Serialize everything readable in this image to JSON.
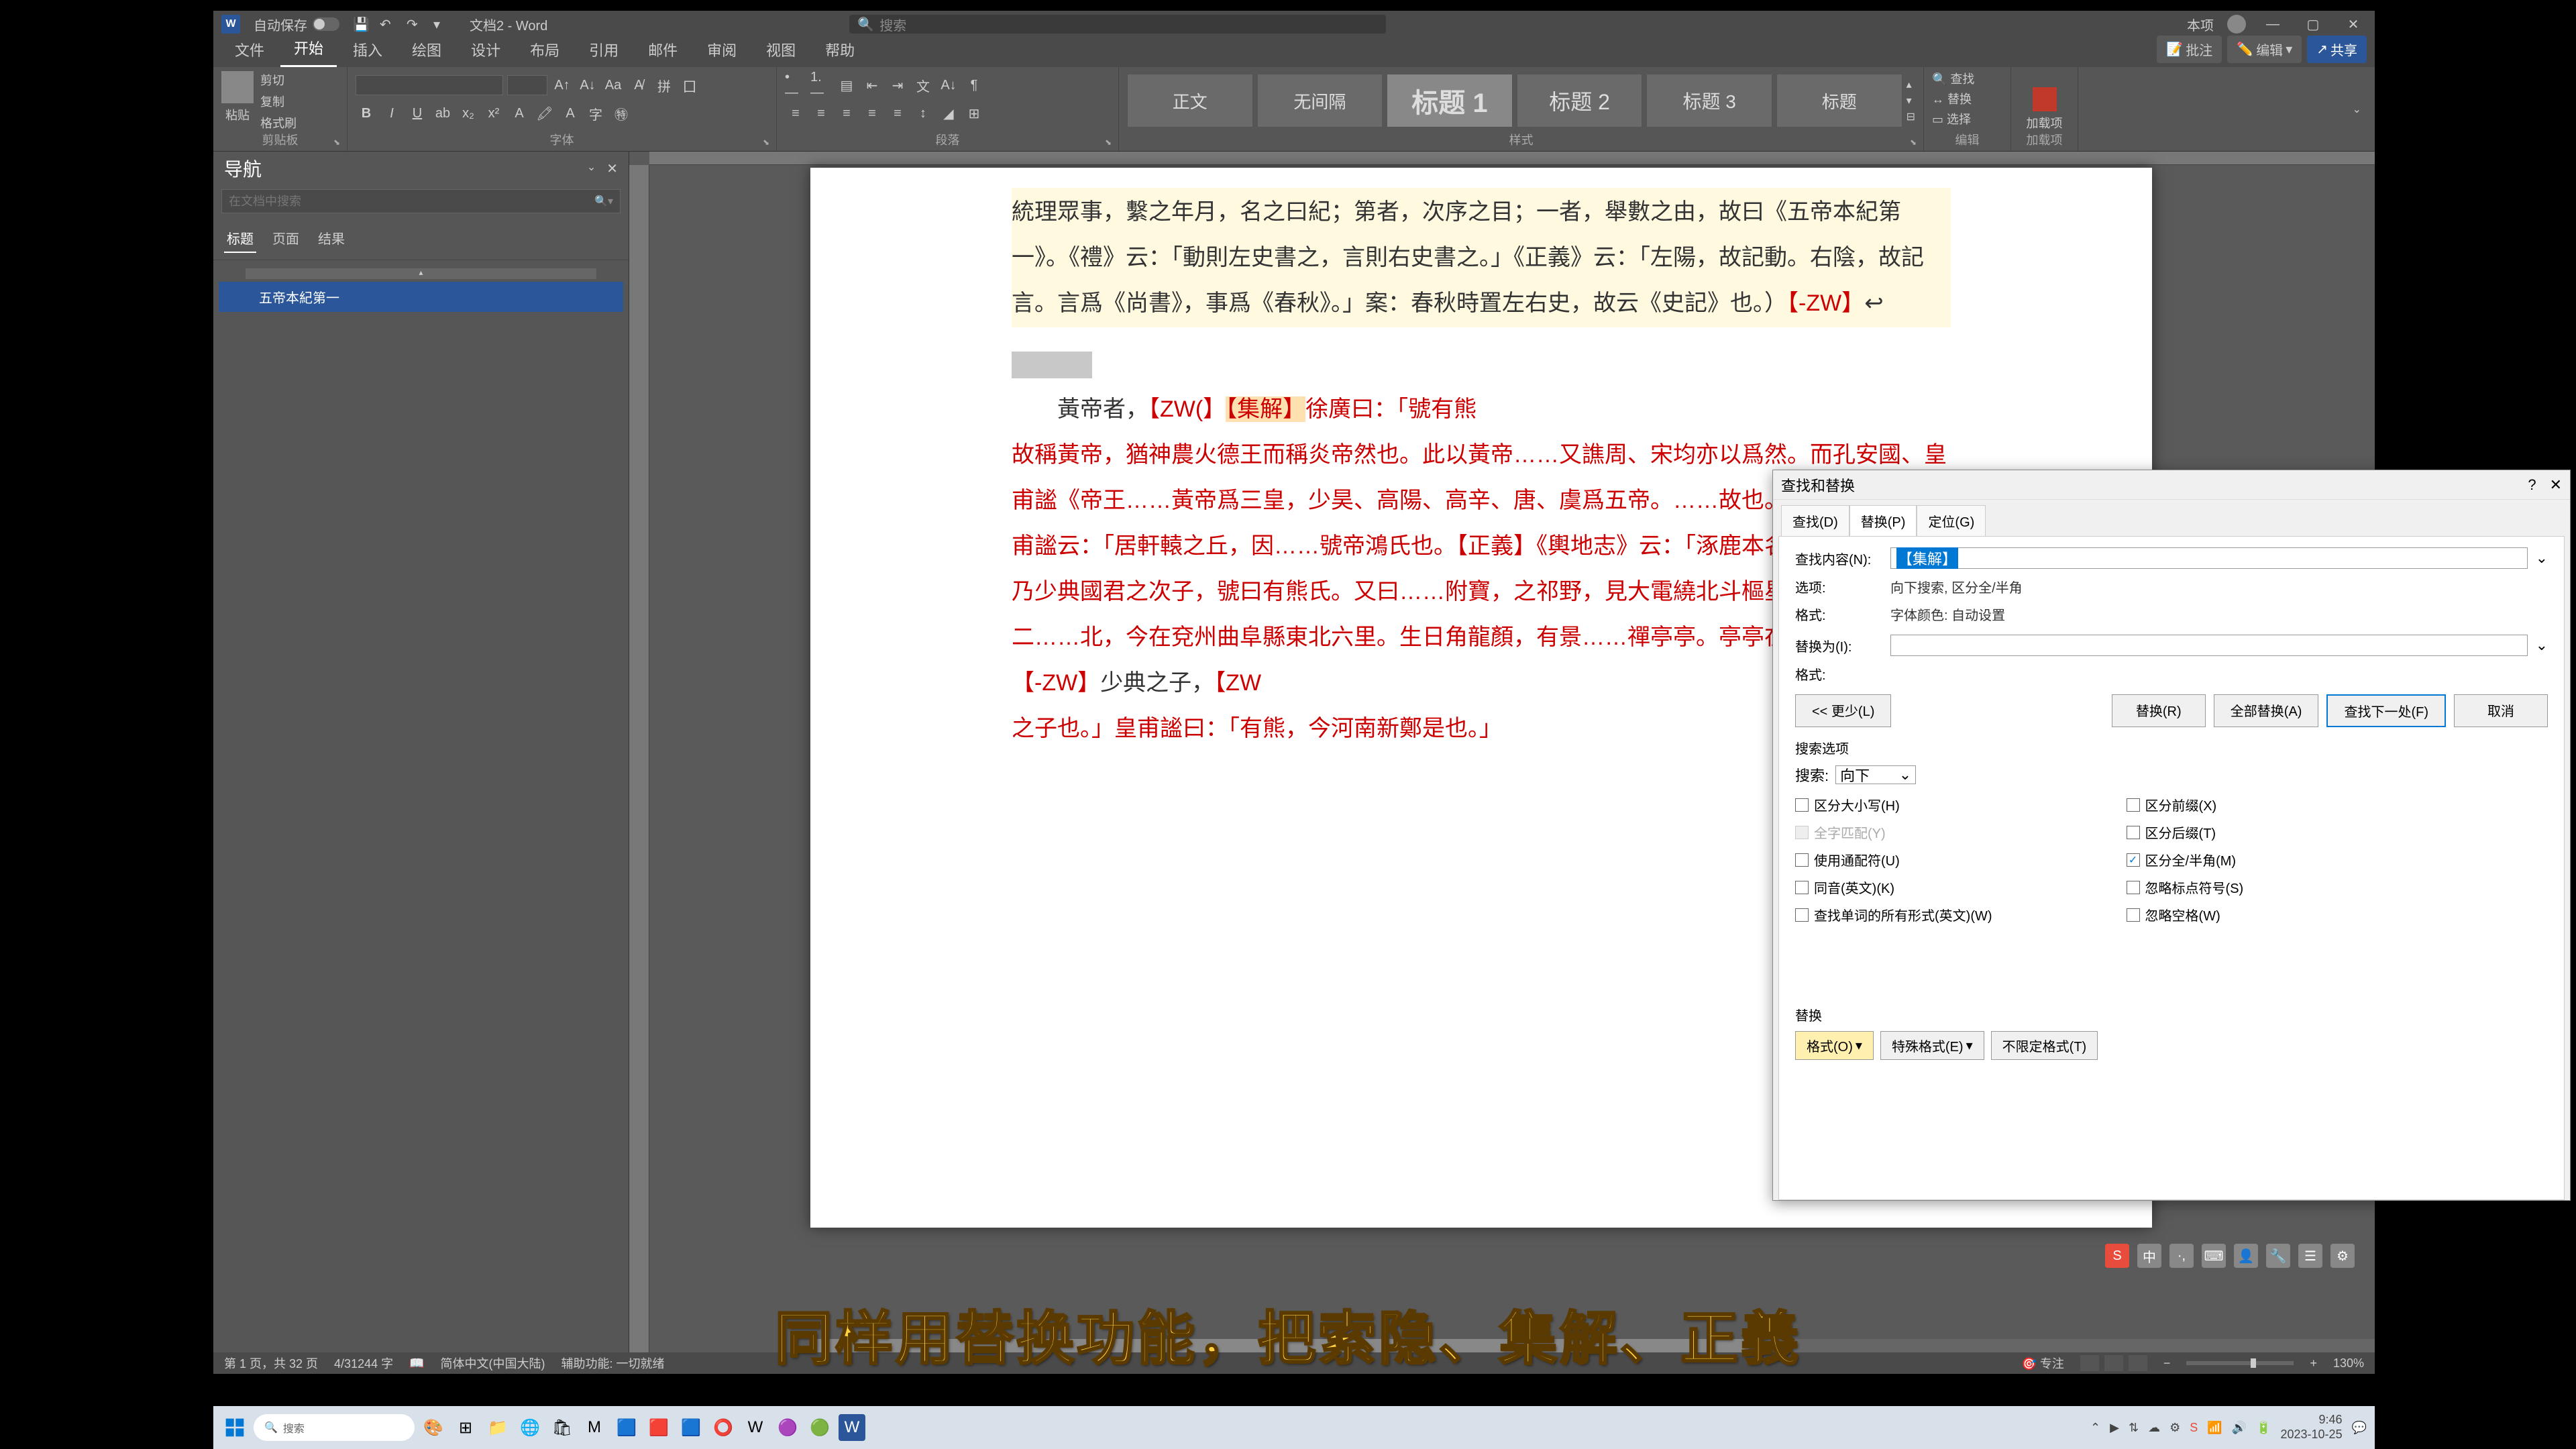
{
  "title_bar": {
    "autosave_label": "自动保存",
    "doc_title": "文档2 - Word",
    "search_placeholder": "搜索",
    "ribbon_display": "本项"
  },
  "ribbon_tabs": [
    "文件",
    "开始",
    "插入",
    "绘图",
    "设计",
    "布局",
    "引用",
    "邮件",
    "审阅",
    "视图",
    "帮助"
  ],
  "ribbon_active_tab": 1,
  "ribbon_right": {
    "comments": "批注",
    "edit": "编辑",
    "share": "共享"
  },
  "ribbon_groups": {
    "clipboard": {
      "label": "剪贴板",
      "paste": "粘贴",
      "cut": "剪切",
      "copy": "复制",
      "format_painter": "格式刷"
    },
    "font": {
      "label": "字体"
    },
    "paragraph": {
      "label": "段落"
    },
    "styles": {
      "label": "样式",
      "items": [
        "正文",
        "无间隔",
        "标题 1",
        "标题 2",
        "标题 3",
        "标题"
      ]
    },
    "editing": {
      "label": "编辑",
      "find": "查找",
      "replace": "替换",
      "select": "选择"
    },
    "addins": {
      "label": "加载项",
      "add": "加载项"
    }
  },
  "nav_pane": {
    "title": "导航",
    "search_placeholder": "在文档中搜索",
    "tabs": [
      "标题",
      "页面",
      "结果"
    ],
    "active_tab": 0,
    "items": [
      "五帝本紀第一"
    ]
  },
  "document": {
    "para1": "統理眾事，繫之年月，名之曰紀；第者，次序之目；一者，舉數之由，故曰《五帝本紀第一》。《禮》云：「動則左史書之，言則右史書之。」《正義》云：「左陽，故記動。右陰，故記言。言爲《尚書》，事爲《春秋》。」案：春秋時置左右史，故云《史記》也。）",
    "zw_close1": "【-ZW】",
    "para2_start": "　　黃帝者，",
    "zw_open": "【ZW(】",
    "jijie": "【集解】",
    "para2_cont": "徐廣曰：「號有熊",
    "para_red_body": "故稱黃帝，猶神農火德王而稱炎帝然也。此以黃帝……又譙周、宋均亦以爲然。而孔安國、皇甫謐《帝王……黃帝爲三皇，少昊、高陽、高辛、唐、虞爲五帝。……故也。亦號軒轅氏。皇甫謐云：「居軒轅之丘，因……號帝鴻氏也。【正義】《輿地志》云：「涿鹿本名……有熊國君，乃少典國君之次子，號曰有熊氏。又曰……附寶，之祁野，見大電繞北斗樞星，感而懷孕，二……北，今在兗州曲阜縣東北六里。生日角龍顏，有景……禪亭亭。亭亭在牟陰。）",
    "zw_close2": "【-ZW】",
    "para2_end": "少典之子，",
    "zw_open2": "【ZW",
    "para3": "之子也。」皇甫謐曰：「有熊，今河南新鄭是也。」"
  },
  "dialog": {
    "title": "查找和替换",
    "tabs": [
      "查找(D)",
      "替换(P)",
      "定位(G)"
    ],
    "active_tab": 1,
    "find_label": "查找内容(N):",
    "find_value": "【集解】",
    "options_label": "选项:",
    "options_value": "向下搜索, 区分全/半角",
    "format_label": "格式:",
    "format_value": "字体颜色: 自动设置",
    "replace_label": "替换为(I):",
    "replace_value": "",
    "format2_label": "格式:",
    "less_btn": "<< 更少(L)",
    "replace_btn": "替换(R)",
    "replace_all_btn": "全部替换(A)",
    "find_next_btn": "查找下一处(F)",
    "cancel_btn": "取消",
    "search_options_title": "搜索选项",
    "search_label": "搜索:",
    "search_direction": "向下",
    "checkboxes_left": [
      {
        "label": "区分大小写(H)",
        "checked": false,
        "disabled": false
      },
      {
        "label": "全字匹配(Y)",
        "checked": false,
        "disabled": true
      },
      {
        "label": "使用通配符(U)",
        "checked": false,
        "disabled": false
      },
      {
        "label": "同音(英文)(K)",
        "checked": false,
        "disabled": false
      },
      {
        "label": "查找单词的所有形式(英文)(W)",
        "checked": false,
        "disabled": false
      }
    ],
    "checkboxes_right": [
      {
        "label": "区分前缀(X)",
        "checked": false
      },
      {
        "label": "区分后缀(T)",
        "checked": false
      },
      {
        "label": "区分全/半角(M)",
        "checked": true
      },
      {
        "label": "忽略标点符号(S)",
        "checked": false
      },
      {
        "label": "忽略空格(W)",
        "checked": false
      }
    ],
    "replace_section_title": "替换",
    "format_btn": "格式(O)",
    "special_btn": "特殊格式(E)",
    "no_format_btn": "不限定格式(T)"
  },
  "status_bar": {
    "page": "第 1 页，共 32 页",
    "words": "4/31244 字",
    "language": "简体中文(中国大陆)",
    "accessibility": "辅助功能: 一切就绪",
    "focus": "专注",
    "zoom": "130%"
  },
  "subtitle_text": "同样用替换功能，把索隐、集解、正義",
  "taskbar": {
    "search": "搜索",
    "time": "9:46",
    "date": "2023-10-25"
  }
}
